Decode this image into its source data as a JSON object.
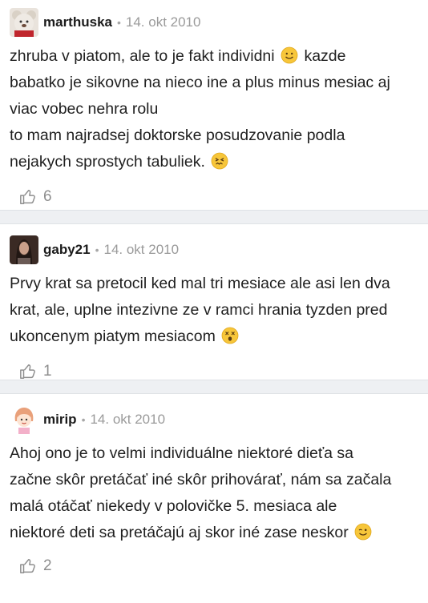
{
  "comments": [
    {
      "author": "marthuska",
      "date": "14. okt 2010",
      "avatar_icon": "teddy-bear-avatar",
      "lines": [
        "zhruba v piatom, ale to je fakt individni",
        "kazde",
        "babatko je sikovne na nieco ine a plus minus mesiac aj",
        "viac vobec nehra rolu",
        "to mam najradsej doktorske posudzovanie podla",
        "nejakych sprostych tabuliek."
      ],
      "likes": "6"
    },
    {
      "author": "gaby21",
      "date": "14. okt 2010",
      "avatar_icon": "woman-photo-avatar",
      "lines": [
        "Prvy krat sa pretocil ked mal tri mesiace ale asi len dva",
        "krat, ale, uplne intezivne ze v ramci hrania tyzden pred",
        "ukoncenym piatym mesiacom"
      ],
      "likes": "1"
    },
    {
      "author": "mirip",
      "date": "14. okt 2010",
      "avatar_icon": "cartoon-girl-avatar",
      "lines": [
        "Ahoj ono je to velmi individuálne niektoré dieťa sa",
        "začne skôr pretáčať iné skôr prihovárať, nám sa začala",
        "malá otáčať niekedy v polovičke 5. mesiaca ale",
        "niektoré deti sa pretáčajú aj skor iné zase neskor"
      ],
      "likes": "2"
    }
  ],
  "separator_dot": "•",
  "colors": {
    "separator": "#eef0f3",
    "muted": "#9a9a9a",
    "emoji": "#f7c63a"
  }
}
